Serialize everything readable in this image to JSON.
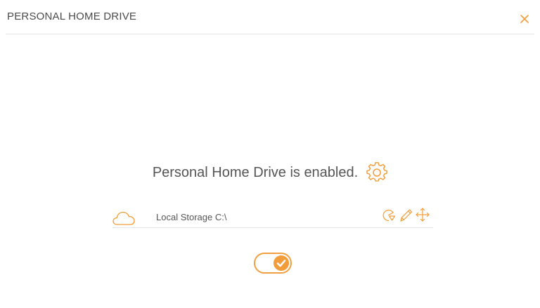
{
  "dialog": {
    "title": "PERSONAL HOME DRIVE",
    "close_icon": "close-icon"
  },
  "status": {
    "text": "Personal Home Drive is enabled.",
    "settings_icon": "gear-icon"
  },
  "storage": {
    "icon": "cloud-icon",
    "label": "Local Storage C:\\",
    "actions": [
      "usage-chart-icon",
      "pencil-icon",
      "move-icon"
    ]
  },
  "toggle": {
    "enabled": true,
    "icon": "checkmark-icon"
  },
  "colors": {
    "accent": "#f29d3a",
    "text": "#555555",
    "title": "#4a4a4a",
    "divider": "#e3e3e3"
  }
}
